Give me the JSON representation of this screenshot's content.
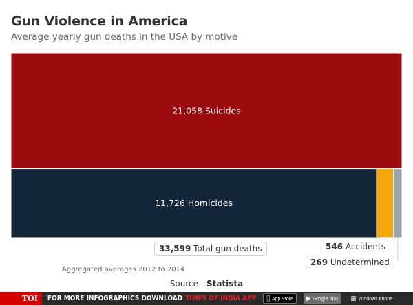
{
  "header": {
    "title": "Gun Violence in America",
    "subtitle": "Average yearly gun deaths in the USA by motive"
  },
  "chart_data": {
    "type": "treemap",
    "title": "Gun Violence in America",
    "subtitle": "Average yearly gun deaths in the USA by motive",
    "total": 33599,
    "total_label": "Total gun deaths",
    "items": [
      {
        "name": "Suicides",
        "value": 21058,
        "color": "#9c0c0f"
      },
      {
        "name": "Homicides",
        "value": 11726,
        "color": "#14263a"
      },
      {
        "name": "Accidents",
        "value": 546,
        "color": "#f4a70d"
      },
      {
        "name": "Undetermined",
        "value": 269,
        "color": "#9ba2ab"
      }
    ]
  },
  "labels": {
    "total_value": "33,599",
    "total_text": "Total gun deaths",
    "accidents_value": "546",
    "accidents_text": "Accidents",
    "undetermined_value": "269",
    "undetermined_text": "Undetermined",
    "note": "Aggregated averages 2012 to 2014",
    "source_prefix": "Source - ",
    "source_brand": "Statista"
  },
  "banner": {
    "logo": "TOI",
    "text": "FOR MORE  INFOGRAPHICS DOWNLOAD",
    "highlight": "TIMES OF INDIA  APP",
    "app_store": "App Store",
    "app_store_small": "Available on the",
    "google_play": "Google play",
    "windows_phone": "Windows Phone",
    "apple_icon": "apple-icon",
    "play_icon": "play-icon",
    "windows_icon": "windows-icon"
  }
}
